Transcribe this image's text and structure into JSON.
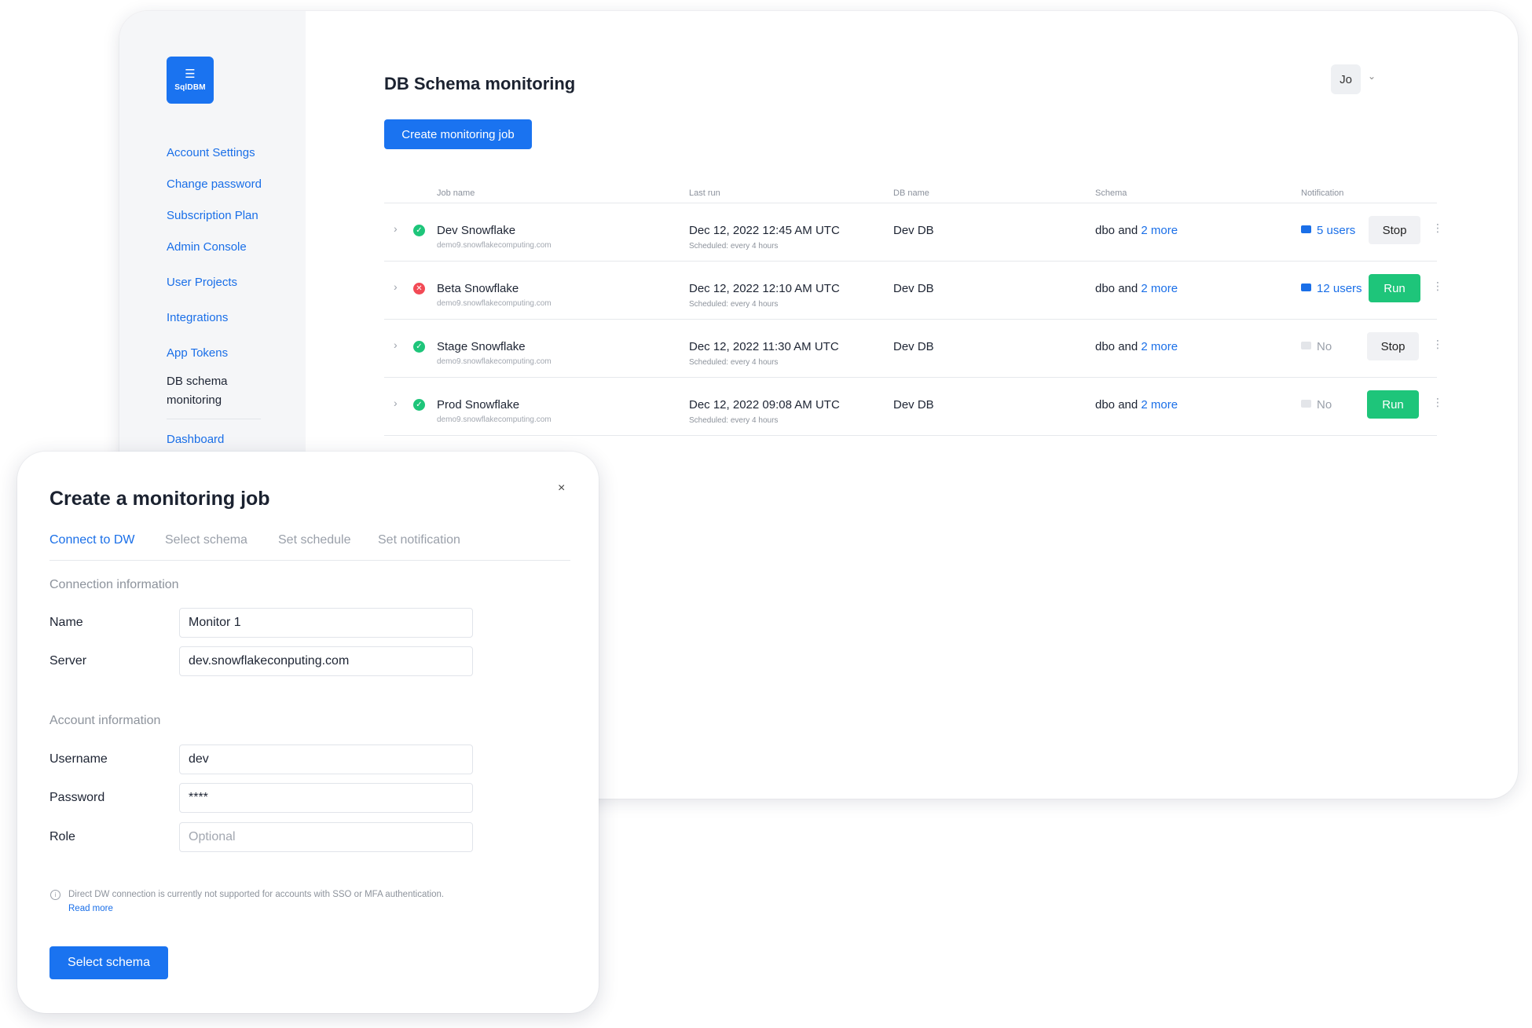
{
  "brand": {
    "logo_text": "SqlDBM",
    "accent": "#1a73f0"
  },
  "sidebar": {
    "items": [
      {
        "label": "Account Settings"
      },
      {
        "label": "Change password"
      },
      {
        "label": "Subscription Plan"
      },
      {
        "label": "Admin Console"
      },
      {
        "label": "User Projects"
      },
      {
        "label": "Integrations"
      },
      {
        "label": "App Tokens"
      },
      {
        "label": "DB schema monitoring"
      },
      {
        "label": "Dashboard"
      }
    ]
  },
  "header": {
    "title": "DB Schema monitoring",
    "create_button": "Create monitoring job",
    "user_initials": "Jo"
  },
  "table": {
    "columns": [
      "Job name",
      "Last run",
      "DB name",
      "Schema",
      "Notification"
    ],
    "rows": [
      {
        "status": "success",
        "name": "Dev Snowflake",
        "host": "demo9.snowflakecomputing.com",
        "last_run": "Dec 12, 2022 12:45 AM UTC",
        "schedule": "Scheduled:  every 4 hours",
        "db_name": "Dev DB",
        "schema_prefix": "dbo and",
        "schema_more": "2 more",
        "notification": "5 users",
        "action": "Stop"
      },
      {
        "status": "error",
        "name": "Beta Snowflake",
        "host": "demo9.snowflakecomputing.com",
        "last_run": "Dec 12, 2022 12:10 AM UTC",
        "schedule": "Scheduled:  every 4 hours",
        "db_name": "Dev DB",
        "schema_prefix": "dbo and",
        "schema_more": "2 more",
        "notification": "12 users",
        "action": "Run"
      },
      {
        "status": "success",
        "name": "Stage Snowflake",
        "host": "demo9.snowflakecomputing.com",
        "last_run": "Dec 12, 2022 11:30 AM UTC",
        "schedule": "Scheduled:  every 4 hours",
        "db_name": "Dev DB",
        "schema_prefix": "dbo and",
        "schema_more": "2 more",
        "notification": "No",
        "action": "Stop"
      },
      {
        "status": "success",
        "name": "Prod Snowflake",
        "host": "demo9.snowflakecomputing.com",
        "last_run": "Dec 12, 2022 09:08 AM UTC",
        "schedule": "Scheduled:  every 4 hours",
        "db_name": "Dev DB",
        "schema_prefix": "dbo and",
        "schema_more": "2 more",
        "notification": "No",
        "action": "Run"
      }
    ]
  },
  "modal": {
    "title": "Create a monitoring job",
    "close": "×",
    "tabs": [
      {
        "label": "Connect to DW",
        "active": true
      },
      {
        "label": "Select schema",
        "active": false
      },
      {
        "label": "Set schedule",
        "active": false
      },
      {
        "label": "Set notification",
        "active": false
      }
    ],
    "connection_section": "Connection information",
    "account_section": "Account information",
    "fields": {
      "name": {
        "label": "Name",
        "value": "Monitor 1"
      },
      "server": {
        "label": "Server",
        "value": "dev.snowflakeconputing.com"
      },
      "username": {
        "label": "Username",
        "value": "dev"
      },
      "password": {
        "label": "Password",
        "value": "****"
      },
      "role": {
        "label": "Role",
        "value": "",
        "placeholder": "Optional"
      }
    },
    "info_text": "Direct DW connection is currently not supported for accounts with SSO or MFA authentication.",
    "info_link": "Read more",
    "submit": "Select schema"
  },
  "colors": {
    "success": "#1ec57a",
    "error": "#f24a55",
    "link": "#1a6fe8"
  }
}
